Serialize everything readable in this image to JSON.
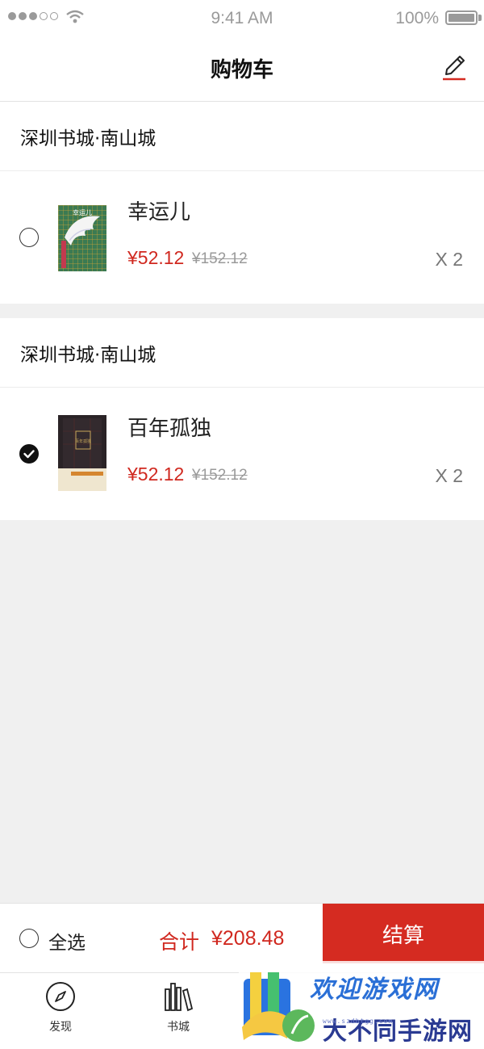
{
  "status_bar": {
    "time": "9:41 AM",
    "battery": "100%",
    "battery_level": 1.0
  },
  "header": {
    "title": "购物车",
    "edit_icon": "pencil-icon"
  },
  "stores": [
    {
      "name": "深圳书城·南山城",
      "items": [
        {
          "title": "幸运儿",
          "price": "¥52.12",
          "original_price": "¥152.12",
          "quantity": "X 2",
          "selected": false,
          "cover_text": "幸运儿"
        }
      ]
    },
    {
      "name": "深圳书城·南山城",
      "items": [
        {
          "title": "百年孤独",
          "price": "¥52.12",
          "original_price": "¥152.12",
          "quantity": "X 2",
          "selected": true,
          "cover_text": "百年孤独"
        }
      ]
    }
  ],
  "checkout": {
    "select_all_label": "全选",
    "total_label": "合计",
    "total_value": "¥208.48",
    "checkout_label": "结算"
  },
  "tabbar": [
    {
      "label": "发现",
      "icon": "compass-icon"
    },
    {
      "label": "书城",
      "icon": "bookshelf-icon"
    }
  ],
  "watermark": {
    "line1": "欢迎游戏网",
    "line2": "大不同手游网",
    "url": "www.szdbtgg.com"
  },
  "colors": {
    "accent": "#d52b21",
    "price": "#d0281f",
    "background": "#f0f0f0"
  }
}
